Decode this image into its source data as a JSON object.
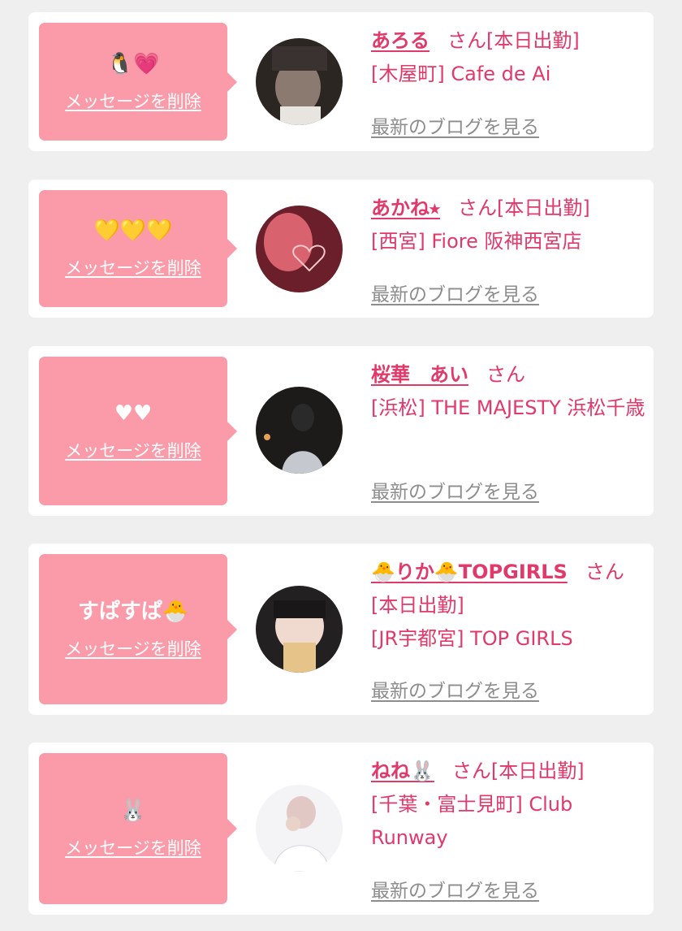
{
  "messages": [
    {
      "bubble_text": "🐧💗",
      "delete_label": "メッセージを削除",
      "name": "あろる",
      "honorific": "さん",
      "status": "[本日出勤]",
      "shop": "[木屋町] Cafe de Ai",
      "blog_label": "最新のブログを見る",
      "avatar_colors": [
        "#2c2623",
        "#8a7a70"
      ]
    },
    {
      "bubble_text": "💛💛💛",
      "delete_label": "メッセージを削除",
      "name": "あかね⭑",
      "honorific": "さん",
      "status": "[本日出勤]",
      "shop": "[西宮] Fiore 阪神西宮店",
      "blog_label": "最新のブログを見る",
      "avatar_colors": [
        "#6b1f2a",
        "#d8636e"
      ]
    },
    {
      "bubble_text": "♥♥",
      "delete_label": "メッセージを削除",
      "name": "桜華　あい",
      "honorific": "さん",
      "status": "",
      "shop": "[浜松] THE MAJESTY 浜松千歳",
      "blog_label": "最新のブログを見る",
      "avatar_colors": [
        "#1d1a1a",
        "#c5c8cf"
      ]
    },
    {
      "bubble_text": "すぱすぱ🐣",
      "delete_label": "メッセージを削除",
      "name": "🐣りか🐣TOPGIRLS",
      "honorific": "さん",
      "status": "[本日出勤]",
      "shop": "[JR宇都宮] TOP GIRLS",
      "blog_label": "最新のブログを見る",
      "avatar_colors": [
        "#222021",
        "#e6c489"
      ]
    },
    {
      "bubble_text": "🐰",
      "delete_label": "メッセージを削除",
      "name": "ねね🐰",
      "honorific": "さん",
      "status": "[本日出勤]",
      "shop": "[千葉・富士見町] Club Runway",
      "blog_label": "最新のブログを見る",
      "avatar_colors": [
        "#f4f3f6",
        "#e2c8c4"
      ]
    }
  ]
}
